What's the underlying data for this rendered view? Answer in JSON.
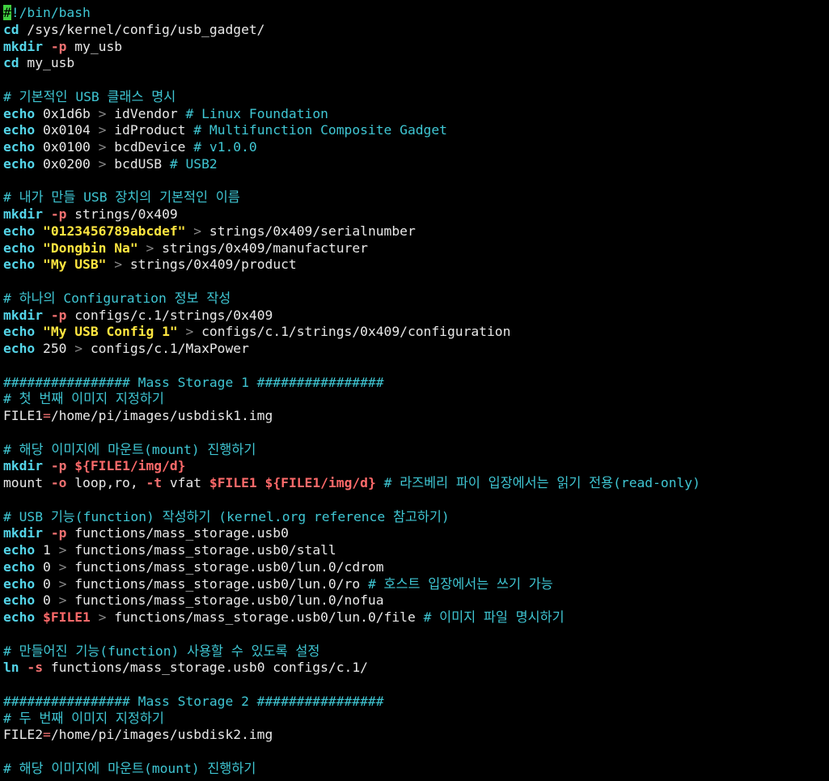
{
  "colors": {
    "background": "#000000",
    "default": "#e8e8e8",
    "comment": "#3fc6d3",
    "keyword": "#54d4e8",
    "flag": "#f07070",
    "string": "#ffe640",
    "variable": "#ff6a6a",
    "operator": "#888888",
    "cursor": "#40d040"
  },
  "lines": [
    [
      {
        "t": "#",
        "c": "cursor"
      },
      {
        "t": "!/bin/bash",
        "c": "comment"
      }
    ],
    [
      {
        "t": "cd",
        "c": "keyword",
        "b": true
      },
      {
        "t": " /sys/kernel/config/usb_gadget/",
        "c": "default"
      }
    ],
    [
      {
        "t": "mkdir",
        "c": "keyword",
        "b": true
      },
      {
        "t": " ",
        "c": "default"
      },
      {
        "t": "-p",
        "c": "flag",
        "b": true
      },
      {
        "t": " my_usb",
        "c": "default"
      }
    ],
    [
      {
        "t": "cd",
        "c": "keyword",
        "b": true
      },
      {
        "t": " my_usb",
        "c": "default"
      }
    ],
    [],
    [
      {
        "t": "# 기본적인 USB 클래스 명시",
        "c": "comment"
      }
    ],
    [
      {
        "t": "echo",
        "c": "keyword",
        "b": true
      },
      {
        "t": " 0x1d6b ",
        "c": "default"
      },
      {
        "t": ">",
        "c": "operator"
      },
      {
        "t": " idVendor ",
        "c": "default"
      },
      {
        "t": "# Linux Foundation",
        "c": "comment"
      }
    ],
    [
      {
        "t": "echo",
        "c": "keyword",
        "b": true
      },
      {
        "t": " 0x0104 ",
        "c": "default"
      },
      {
        "t": ">",
        "c": "operator"
      },
      {
        "t": " idProduct ",
        "c": "default"
      },
      {
        "t": "# Multifunction Composite Gadget",
        "c": "comment"
      }
    ],
    [
      {
        "t": "echo",
        "c": "keyword",
        "b": true
      },
      {
        "t": " 0x0100 ",
        "c": "default"
      },
      {
        "t": ">",
        "c": "operator"
      },
      {
        "t": " bcdDevice ",
        "c": "default"
      },
      {
        "t": "# v1.0.0",
        "c": "comment"
      }
    ],
    [
      {
        "t": "echo",
        "c": "keyword",
        "b": true
      },
      {
        "t": " 0x0200 ",
        "c": "default"
      },
      {
        "t": ">",
        "c": "operator"
      },
      {
        "t": " bcdUSB ",
        "c": "default"
      },
      {
        "t": "# USB2",
        "c": "comment"
      }
    ],
    [],
    [
      {
        "t": "# 내가 만들 USB 장치의 기본적인 이름",
        "c": "comment"
      }
    ],
    [
      {
        "t": "mkdir",
        "c": "keyword",
        "b": true
      },
      {
        "t": " ",
        "c": "default"
      },
      {
        "t": "-p",
        "c": "flag",
        "b": true
      },
      {
        "t": " strings/0x409",
        "c": "default"
      }
    ],
    [
      {
        "t": "echo",
        "c": "keyword",
        "b": true
      },
      {
        "t": " ",
        "c": "default"
      },
      {
        "t": "\"0123456789abcdef\"",
        "c": "string",
        "b": true
      },
      {
        "t": " ",
        "c": "default"
      },
      {
        "t": ">",
        "c": "operator"
      },
      {
        "t": " strings/0x409/serialnumber",
        "c": "default"
      }
    ],
    [
      {
        "t": "echo",
        "c": "keyword",
        "b": true
      },
      {
        "t": " ",
        "c": "default"
      },
      {
        "t": "\"Dongbin Na\"",
        "c": "string",
        "b": true
      },
      {
        "t": " ",
        "c": "default"
      },
      {
        "t": ">",
        "c": "operator"
      },
      {
        "t": " strings/0x409/manufacturer",
        "c": "default"
      }
    ],
    [
      {
        "t": "echo",
        "c": "keyword",
        "b": true
      },
      {
        "t": " ",
        "c": "default"
      },
      {
        "t": "\"My USB\"",
        "c": "string",
        "b": true
      },
      {
        "t": " ",
        "c": "default"
      },
      {
        "t": ">",
        "c": "operator"
      },
      {
        "t": " strings/0x409/product",
        "c": "default"
      }
    ],
    [],
    [
      {
        "t": "# 하나의 Configuration 정보 작성",
        "c": "comment"
      }
    ],
    [
      {
        "t": "mkdir",
        "c": "keyword",
        "b": true
      },
      {
        "t": " ",
        "c": "default"
      },
      {
        "t": "-p",
        "c": "flag",
        "b": true
      },
      {
        "t": " configs/c.1/strings/0x409",
        "c": "default"
      }
    ],
    [
      {
        "t": "echo",
        "c": "keyword",
        "b": true
      },
      {
        "t": " ",
        "c": "default"
      },
      {
        "t": "\"My USB Config 1\"",
        "c": "string",
        "b": true
      },
      {
        "t": " ",
        "c": "default"
      },
      {
        "t": ">",
        "c": "operator"
      },
      {
        "t": " configs/c.1/strings/0x409/configuration",
        "c": "default"
      }
    ],
    [
      {
        "t": "echo",
        "c": "keyword",
        "b": true
      },
      {
        "t": " 250 ",
        "c": "default"
      },
      {
        "t": ">",
        "c": "operator"
      },
      {
        "t": " configs/c.1/MaxPower",
        "c": "default"
      }
    ],
    [],
    [
      {
        "t": "################ Mass Storage 1 ################",
        "c": "comment"
      }
    ],
    [
      {
        "t": "# 첫 번째 이미지 지정하기",
        "c": "comment"
      }
    ],
    [
      {
        "t": "FILE1",
        "c": "default"
      },
      {
        "t": "=",
        "c": "flag"
      },
      {
        "t": "/home/pi/images/usbdisk1.img",
        "c": "default"
      }
    ],
    [],
    [
      {
        "t": "# 해당 이미지에 마운트(mount) 진행하기",
        "c": "comment"
      }
    ],
    [
      {
        "t": "mkdir",
        "c": "keyword",
        "b": true
      },
      {
        "t": " ",
        "c": "default"
      },
      {
        "t": "-p",
        "c": "flag",
        "b": true
      },
      {
        "t": " ",
        "c": "default"
      },
      {
        "t": "${FILE1/img/d}",
        "c": "variable",
        "b": true
      }
    ],
    [
      {
        "t": "mount ",
        "c": "default"
      },
      {
        "t": "-o",
        "c": "flag",
        "b": true
      },
      {
        "t": " loop,ro, ",
        "c": "default"
      },
      {
        "t": "-t",
        "c": "flag",
        "b": true
      },
      {
        "t": " vfat ",
        "c": "default"
      },
      {
        "t": "$FILE1",
        "c": "variable",
        "b": true
      },
      {
        "t": " ",
        "c": "default"
      },
      {
        "t": "${FILE1/img/d}",
        "c": "variable",
        "b": true
      },
      {
        "t": " ",
        "c": "default"
      },
      {
        "t": "# 라즈베리 파이 입장에서는 읽기 전용(read-only)",
        "c": "comment"
      }
    ],
    [],
    [
      {
        "t": "# USB 기능(function) 작성하기 (kernel.org reference 참고하기)",
        "c": "comment"
      }
    ],
    [
      {
        "t": "mkdir",
        "c": "keyword",
        "b": true
      },
      {
        "t": " ",
        "c": "default"
      },
      {
        "t": "-p",
        "c": "flag",
        "b": true
      },
      {
        "t": " functions/mass_storage.usb0",
        "c": "default"
      }
    ],
    [
      {
        "t": "echo",
        "c": "keyword",
        "b": true
      },
      {
        "t": " 1 ",
        "c": "default"
      },
      {
        "t": ">",
        "c": "operator"
      },
      {
        "t": " functions/mass_storage.usb0/stall",
        "c": "default"
      }
    ],
    [
      {
        "t": "echo",
        "c": "keyword",
        "b": true
      },
      {
        "t": " 0 ",
        "c": "default"
      },
      {
        "t": ">",
        "c": "operator"
      },
      {
        "t": " functions/mass_storage.usb0/lun.0/cdrom",
        "c": "default"
      }
    ],
    [
      {
        "t": "echo",
        "c": "keyword",
        "b": true
      },
      {
        "t": " 0 ",
        "c": "default"
      },
      {
        "t": ">",
        "c": "operator"
      },
      {
        "t": " functions/mass_storage.usb0/lun.0/ro ",
        "c": "default"
      },
      {
        "t": "# 호스트 입장에서는 쓰기 가능",
        "c": "comment"
      }
    ],
    [
      {
        "t": "echo",
        "c": "keyword",
        "b": true
      },
      {
        "t": " 0 ",
        "c": "default"
      },
      {
        "t": ">",
        "c": "operator"
      },
      {
        "t": " functions/mass_storage.usb0/lun.0/nofua",
        "c": "default"
      }
    ],
    [
      {
        "t": "echo",
        "c": "keyword",
        "b": true
      },
      {
        "t": " ",
        "c": "default"
      },
      {
        "t": "$FILE1",
        "c": "variable",
        "b": true
      },
      {
        "t": " ",
        "c": "default"
      },
      {
        "t": ">",
        "c": "operator"
      },
      {
        "t": " functions/mass_storage.usb0/lun.0/file ",
        "c": "default"
      },
      {
        "t": "# 이미지 파일 명시하기",
        "c": "comment"
      }
    ],
    [],
    [
      {
        "t": "# 만들어진 기능(function) 사용할 수 있도록 설정",
        "c": "comment"
      }
    ],
    [
      {
        "t": "ln",
        "c": "keyword",
        "b": true
      },
      {
        "t": " ",
        "c": "default"
      },
      {
        "t": "-s",
        "c": "flag",
        "b": true
      },
      {
        "t": " functions/mass_storage.usb0 configs/c.1/",
        "c": "default"
      }
    ],
    [],
    [
      {
        "t": "################ Mass Storage 2 ################",
        "c": "comment"
      }
    ],
    [
      {
        "t": "# 두 번째 이미지 지정하기",
        "c": "comment"
      }
    ],
    [
      {
        "t": "FILE2",
        "c": "default"
      },
      {
        "t": "=",
        "c": "flag"
      },
      {
        "t": "/home/pi/images/usbdisk2.img",
        "c": "default"
      }
    ],
    [],
    [
      {
        "t": "# 해당 이미지에 마운트(mount) 진행하기",
        "c": "comment"
      }
    ]
  ]
}
